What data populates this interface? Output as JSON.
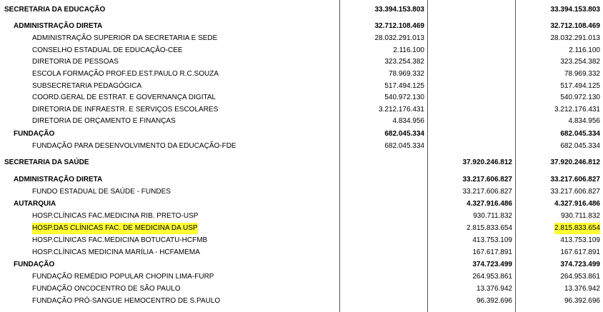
{
  "rows": [
    {
      "label": "SECRETARIA DA EDUCAÇÃO",
      "level": 0,
      "c1": "33.394.153.803",
      "c2": "",
      "c3": "33.394.153.803",
      "hl": false
    },
    {
      "label": "ADMINISTRAÇÃO DIRETA",
      "level": 1,
      "c1": "32.712.108.469",
      "c2": "",
      "c3": "32.712.108.469",
      "hl": false
    },
    {
      "label": "ADMINISTRAÇÃO SUPERIOR DA SECRETARIA E SEDE",
      "level": 2,
      "c1": "28.032.291.013",
      "c2": "",
      "c3": "28.032.291.013",
      "hl": false
    },
    {
      "label": "CONSELHO ESTADUAL DE EDUCAÇÃO-CEE",
      "level": 2,
      "c1": "2.116.100",
      "c2": "",
      "c3": "2.116.100",
      "hl": false
    },
    {
      "label": "DIRETORIA DE PESSOAS",
      "level": 2,
      "c1": "323.254.382",
      "c2": "",
      "c3": "323.254.382",
      "hl": false
    },
    {
      "label": "ESCOLA FORMAÇÃO PROF.ED.EST.PAULO R.C.SOUZA",
      "level": 2,
      "c1": "78.969.332",
      "c2": "",
      "c3": "78.969.332",
      "hl": false
    },
    {
      "label": "SUBSECRETARIA PEDAGÓGICA",
      "level": 2,
      "c1": "517.494.125",
      "c2": "",
      "c3": "517.494.125",
      "hl": false
    },
    {
      "label": "COORD.GERAL DE ESTRAT. E GOVERNANÇA DIGITAL",
      "level": 2,
      "c1": "540.972.130",
      "c2": "",
      "c3": "540.972.130",
      "hl": false
    },
    {
      "label": "DIRETORIA DE INFRAESTR. E SERVIÇOS ESCOLARES",
      "level": 2,
      "c1": "3.212.176.431",
      "c2": "",
      "c3": "3.212.176.431",
      "hl": false
    },
    {
      "label": "DIRETORIA DE ORÇAMENTO E FINANÇAS",
      "level": 2,
      "c1": "4.834.956",
      "c2": "",
      "c3": "4.834.956",
      "hl": false
    },
    {
      "label": "FUNDAÇÃO",
      "level": 1,
      "c1": "682.045.334",
      "c2": "",
      "c3": "682.045.334",
      "hl": false
    },
    {
      "label": "FUNDAÇÃO PARA DESENVOLVIMENTO DA EDUCAÇÃO-FDE",
      "level": 2,
      "c1": "682.045.334",
      "c2": "",
      "c3": "682.045.334",
      "hl": false
    },
    {
      "label": "SECRETARIA DA SAÚDE",
      "level": 0,
      "c1": "",
      "c2": "37.920.246.812",
      "c3": "37.920.246.812",
      "hl": false
    },
    {
      "label": "ADMINISTRAÇÃO DIRETA",
      "level": 1,
      "c1": "",
      "c2": "33.217.606.827",
      "c3": "33.217.606.827",
      "hl": false
    },
    {
      "label": "FUNDO ESTADUAL DE SAÚDE - FUNDES",
      "level": 2,
      "c1": "",
      "c2": "33.217.606.827",
      "c3": "33.217.606.827",
      "hl": false
    },
    {
      "label": "AUTARQUIA",
      "level": 1,
      "c1": "",
      "c2": "4.327.916.486",
      "c3": "4.327.916.486",
      "hl": false
    },
    {
      "label": "HOSP.CLÍNICAS FAC.MEDICINA RIB. PRETO-USP",
      "level": 2,
      "c1": "",
      "c2": "930.711.832",
      "c3": "930.711.832",
      "hl": false
    },
    {
      "label": "HOSP.DAS CLÍNICAS FAC. DE MEDICINA DA USP",
      "level": 2,
      "c1": "",
      "c2": "2.815.833.654",
      "c3": "2.815.833.654",
      "hl": true
    },
    {
      "label": "HOSP.CLÍNICAS FAC.MEDICINA BOTUCATU-HCFMB",
      "level": 2,
      "c1": "",
      "c2": "413.753.109",
      "c3": "413.753.109",
      "hl": false
    },
    {
      "label": "HOSP.CLÍNICAS MEDICINA MARÍLIA - HCFAMEMA",
      "level": 2,
      "c1": "",
      "c2": "167.617.891",
      "c3": "167.617.891",
      "hl": false
    },
    {
      "label": "FUNDAÇÃO",
      "level": 1,
      "c1": "",
      "c2": "374.723.499",
      "c3": "374.723.499",
      "hl": false
    },
    {
      "label": "FUNDAÇÃO REMÉDIO POPULAR CHOPIN LIMA-FURP",
      "level": 2,
      "c1": "",
      "c2": "264.953.861",
      "c3": "264.953.861",
      "hl": false
    },
    {
      "label": "FUNDAÇÃO ONCOCENTRO DE SÃO PAULO",
      "level": 2,
      "c1": "",
      "c2": "13.376.942",
      "c3": "13.376.942",
      "hl": false
    },
    {
      "label": "FUNDAÇÃO PRÓ-SANGUE HEMOCENTRO DE S.PAULO",
      "level": 2,
      "c1": "",
      "c2": "96.392.696",
      "c3": "96.392.696",
      "hl": false
    }
  ],
  "colors": {
    "highlight": "#ffff33",
    "grid": "#555555"
  }
}
